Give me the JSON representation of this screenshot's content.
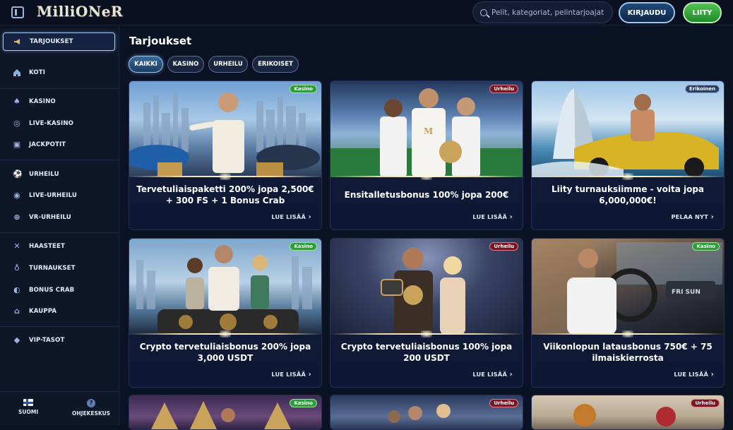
{
  "header": {
    "logo": "MilliONeR",
    "search_placeholder": "Pelit, kategoriat, pelintarjoajat",
    "login_label": "KIRJAUDU",
    "join_label": "LIITY"
  },
  "sidebar": {
    "items": [
      {
        "label": "TARJOUKSET",
        "icon": "megaphone-icon",
        "active": true
      },
      {
        "label": "KOTI",
        "icon": "home-icon"
      },
      {
        "label": "KASINO",
        "icon": "spade-icon"
      },
      {
        "label": "LIVE-KASINO",
        "icon": "chip-icon"
      },
      {
        "label": "JACKPOTIT",
        "icon": "slot-icon"
      },
      {
        "label": "URHEILU",
        "icon": "ball-icon"
      },
      {
        "label": "LIVE-URHEILU",
        "icon": "live-ball-icon"
      },
      {
        "label": "VR-URHEILU",
        "icon": "globe-icon"
      },
      {
        "label": "HAASTEET",
        "icon": "swords-icon"
      },
      {
        "label": "TURNAUKSET",
        "icon": "medal-icon"
      },
      {
        "label": "BONUS CRAB",
        "icon": "crab-icon"
      },
      {
        "label": "KAUPPA",
        "icon": "basket-icon"
      },
      {
        "label": "VIP-TASOT",
        "icon": "diamond-icon"
      }
    ],
    "footer": {
      "language_label": "SUOMI",
      "help_label": "OHJEKESKUS"
    }
  },
  "main": {
    "title": "Tarjoukset",
    "filters": [
      "KAIKKI",
      "KASINO",
      "URHEILU",
      "ERIKOISET"
    ],
    "cards": [
      {
        "badge": "Kasino",
        "text": "Tervetuliaispaketti 200% jopa 2,500€ + 300 FS + 1 Bonus Crab",
        "link": "LUE LISÄÄ"
      },
      {
        "badge": "Urheilu",
        "text": "Ensitalletusbonus 100% jopa 200€",
        "link": "LUE LISÄÄ"
      },
      {
        "badge": "Erikoinen",
        "text": "Liity turnauksiimme - voita jopa 6,000,000€!",
        "link": "PELAA NYT"
      },
      {
        "badge": "Kasino",
        "text": "Crypto tervetuliaisbonus 200% jopa 3,000 USDT",
        "link": "LUE LISÄÄ"
      },
      {
        "badge": "Urheilu",
        "text": "Crypto tervetuliaisbonus 100% jopa 200 USDT",
        "link": "LUE LISÄÄ"
      },
      {
        "badge": "Kasino",
        "text": "Viikonlopun latausbonus 750€ + 75 ilmaiskierrosta",
        "link": "LUE LISÄÄ"
      },
      {
        "badge": "Kasino"
      },
      {
        "badge": "Urheilu"
      },
      {
        "badge": "Urheilu"
      }
    ]
  },
  "colors": {
    "kasino_badge": "#2e9e3a",
    "urheilu_badge": "#7a1524",
    "erikoinen_badge": "#2b3f63",
    "join_button": "#3fb04a"
  }
}
